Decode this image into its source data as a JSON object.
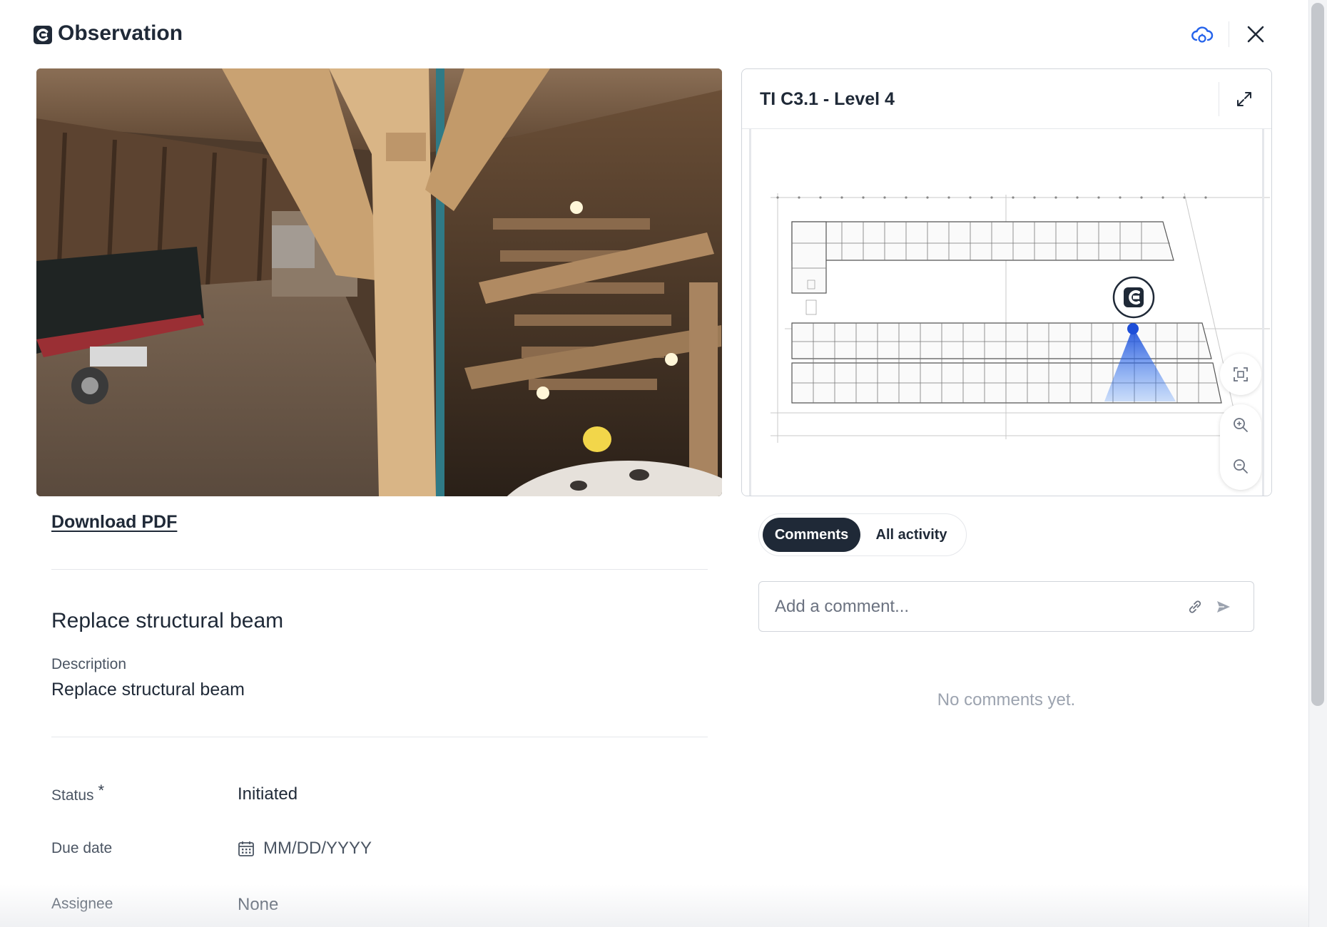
{
  "header": {
    "title": "Observation",
    "icons": {
      "logo": "logo-icon",
      "cloud": "cloud-sync-icon",
      "close": "close-icon"
    },
    "accent_color": "#2563eb"
  },
  "photo": {
    "alt": "photo-360"
  },
  "left": {
    "download_label": "Download PDF",
    "observation_title": "Replace structural beam",
    "description_label": "Description",
    "description_value": "Replace structural beam",
    "fields": {
      "status_label": "Status",
      "status_required": "*",
      "status_value": "Initiated",
      "due_label": "Due date",
      "due_placeholder": "MM/DD/YYYY",
      "assignee_label": "Assignee",
      "assignee_value": "None"
    }
  },
  "map": {
    "title": "TI C3.1 - Level 4",
    "icons": {
      "expand": "expand-icon",
      "fit": "fit-screen-icon",
      "zoom_in": "zoom-in-icon",
      "zoom_out": "zoom-out-icon",
      "marker": "location-marker-icon"
    },
    "cone_color": "#1d4ed8"
  },
  "activity": {
    "tabs": [
      {
        "label": "Comments",
        "active": true
      },
      {
        "label": "All activity",
        "active": false
      }
    ],
    "comment_placeholder": "Add a comment...",
    "empty_message": "No comments yet."
  }
}
